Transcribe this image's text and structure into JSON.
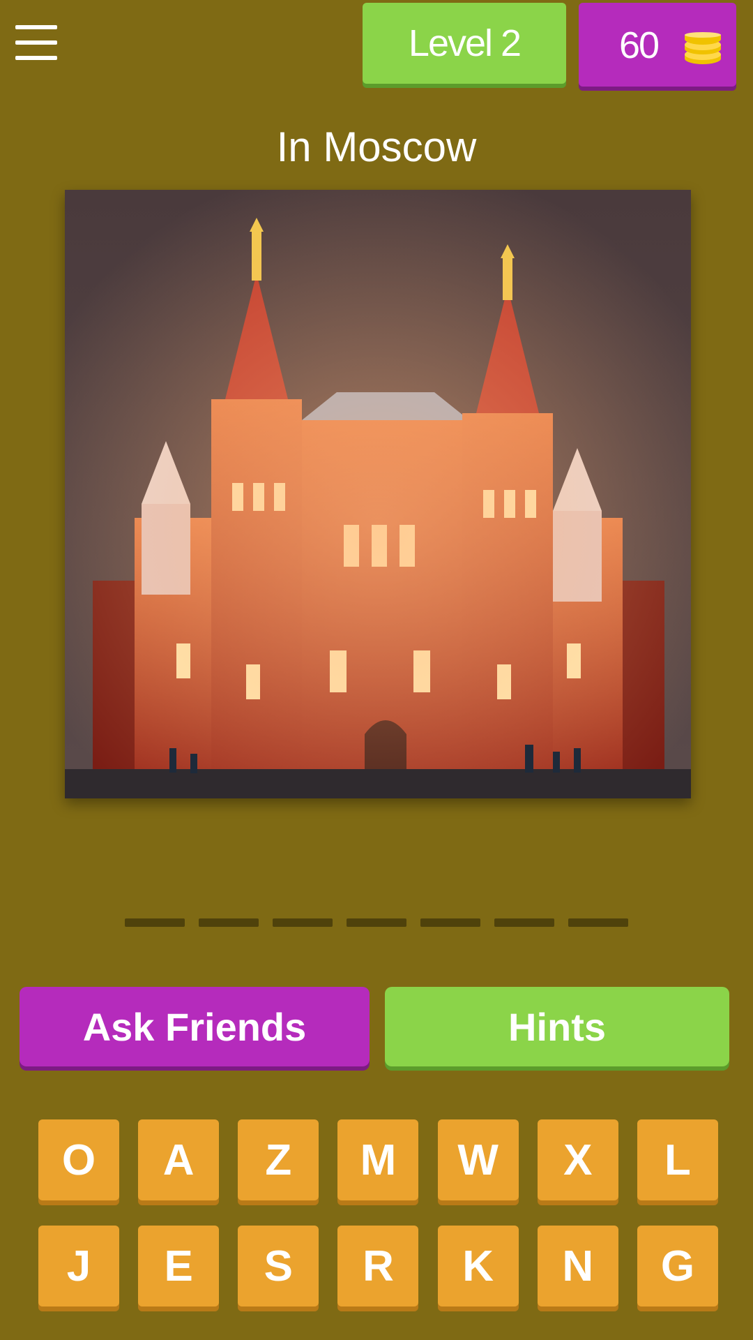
{
  "header": {
    "level_label": "Level 2",
    "coins": "60",
    "menu_icon": "hamburger-menu-icon",
    "coin_icon": "coin-stack-icon"
  },
  "question": "In Moscow",
  "answer": {
    "slot_count": 7
  },
  "buttons": {
    "ask_friends": "Ask Friends",
    "hints": "Hints"
  },
  "keyboard": {
    "row1": [
      "O",
      "A",
      "Z",
      "M",
      "W",
      "X",
      "L"
    ],
    "row2": [
      "J",
      "E",
      "S",
      "R",
      "K",
      "N",
      "G"
    ]
  },
  "colors": {
    "background": "#7f6a14",
    "green": "#8bd449",
    "purple": "#b52bbc",
    "key": "#eba32e"
  }
}
